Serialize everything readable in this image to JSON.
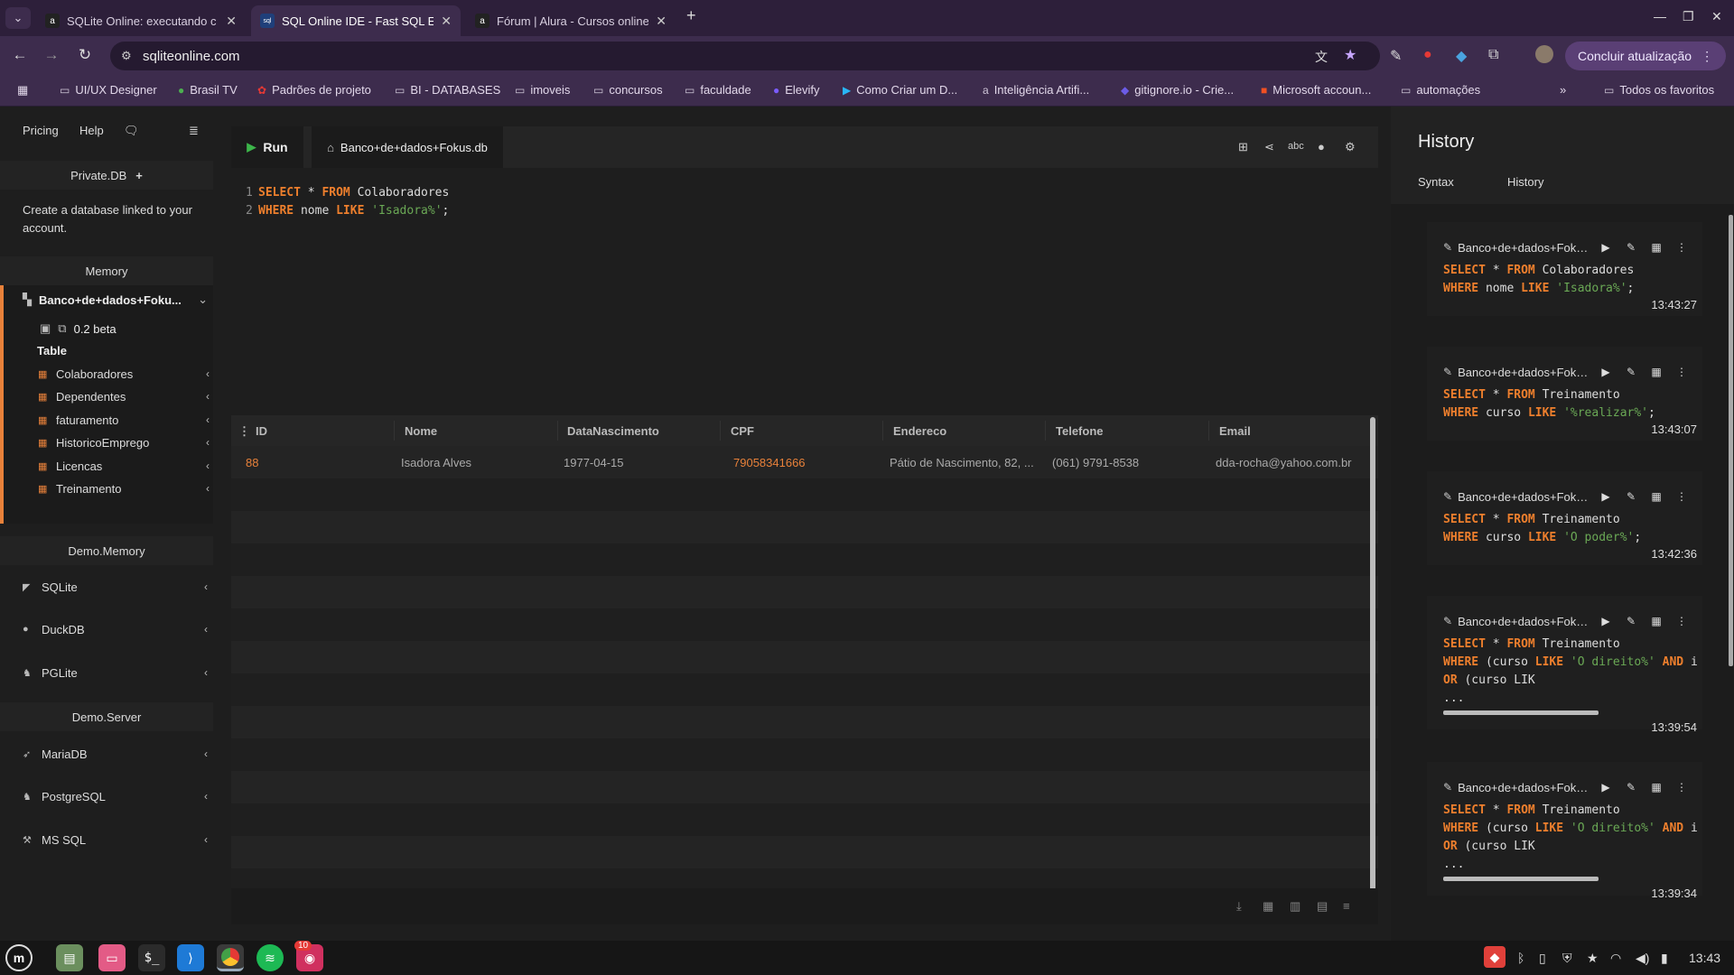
{
  "browser": {
    "tabs": [
      {
        "title": "SQLite Online: executando c",
        "favicon": "a"
      },
      {
        "title": "SQL Online IDE - Fast SQL Ed",
        "favicon": "sql"
      },
      {
        "title": "Fórum | Alura - Cursos online",
        "favicon": "a"
      }
    ],
    "url": "sqliteonline.com",
    "update_label": "Concluir atualização",
    "bookmarks": [
      "UI/UX Designer",
      "Brasil TV",
      "Padrões de projeto",
      "BI - DATABASES",
      "imoveis",
      "concursos",
      "faculdade",
      "Elevify",
      "Como Criar um D...",
      "Inteligência Artifi...",
      "gitignore.io - Crie...",
      "Microsoft accoun...",
      "automações"
    ],
    "all_bookmarks": "Todos os favoritos"
  },
  "sidebar": {
    "pricing": "Pricing",
    "help": "Help",
    "private_db": "Private.DB",
    "private_note": "Create a database linked to your account.",
    "memory": "Memory",
    "db_name": "Banco+de+dados+Foku...",
    "version": "0.2 beta",
    "table_heading": "Table",
    "tables": [
      "Colaboradores",
      "Dependentes",
      "faturamento",
      "HistoricoEmprego",
      "Licencas",
      "Treinamento"
    ],
    "demo_memory": "Demo.Memory",
    "memory_engines": [
      "SQLite",
      "DuckDB",
      "PGLite"
    ],
    "demo_server": "Demo.Server",
    "server_engines": [
      "MariaDB",
      "PostgreSQL",
      "MS SQL"
    ]
  },
  "editor": {
    "run_label": "Run",
    "db_tab": "Banco+de+dados+Fokus.db",
    "line1": {
      "n": "1",
      "k1": "SELECT",
      "p1": " * ",
      "k2": "FROM",
      "p2": " Colaboradores"
    },
    "line2": {
      "n": "2",
      "k1": "WHERE",
      "p1": " nome ",
      "k2": "LIKE",
      "s": " 'Isadora%'",
      "p2": ";"
    }
  },
  "result": {
    "columns": [
      "ID",
      "Nome",
      "DataNascimento",
      "CPF",
      "Endereco",
      "Telefone",
      "Email"
    ],
    "row": {
      "id": "88",
      "nome": "Isadora Alves",
      "nascimento": "1977-04-15",
      "cpf": "79058341666",
      "endereco": "Pátio de Nascimento, 82, ...",
      "telefone": "(061) 9791-8538",
      "email": "dda-rocha@yahoo.com.br"
    }
  },
  "history": {
    "title": "History",
    "tab_syntax": "Syntax",
    "tab_history": "History",
    "entries": [
      {
        "db": "Banco+de+dados+Foku...",
        "time": "13:43:27"
      },
      {
        "db": "Banco+de+dados+Foku...",
        "time": "13:43:07"
      },
      {
        "db": "Banco+de+dados+Foku...",
        "time": "13:42:36"
      },
      {
        "db": "Banco+de+dados+Foku...",
        "time": "13:39:54"
      },
      {
        "db": "Banco+de+dados+Foku...",
        "time": "13:39:34"
      }
    ],
    "code": {
      "select": "SELECT",
      "star": " * ",
      "from": "FROM",
      "where": "WHERE",
      "like": "LIKE",
      "and": "AND",
      "or": "OR",
      "colab": " Colaboradores",
      "treino": " Treinamento",
      "nome": " nome ",
      "curso": " curso ",
      "paren_curso": " (curso ",
      "isadora": "'Isadora%'",
      "realizar": "'%realizar%'",
      "poder": "'O poder%'",
      "direito": "'O direito%'",
      "semi": ";",
      "and_tail": " i",
      "or_tail": " (curso LIK",
      "ellipsis": "..."
    }
  },
  "taskbar": {
    "badge": "10",
    "clock": "13:43"
  }
}
